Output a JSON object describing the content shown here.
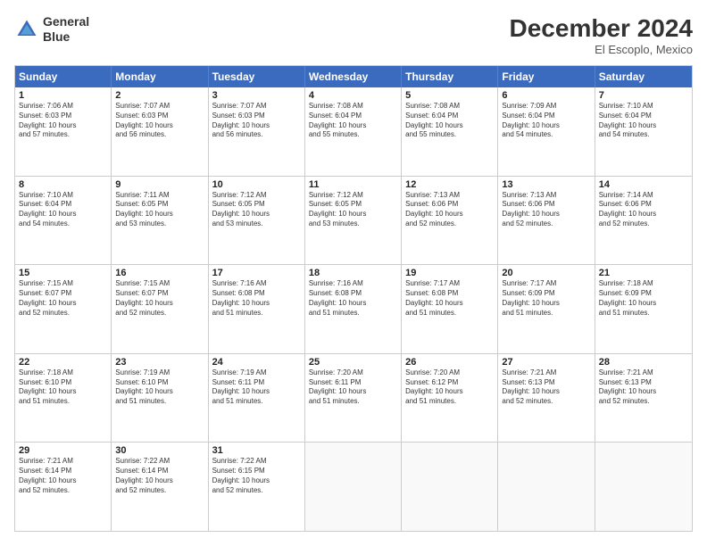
{
  "header": {
    "logo_line1": "General",
    "logo_line2": "Blue",
    "month": "December 2024",
    "location": "El Escoplo, Mexico"
  },
  "days_of_week": [
    "Sunday",
    "Monday",
    "Tuesday",
    "Wednesday",
    "Thursday",
    "Friday",
    "Saturday"
  ],
  "rows": [
    [
      {
        "day": "",
        "text": ""
      },
      {
        "day": "2",
        "text": "Sunrise: 7:07 AM\nSunset: 6:03 PM\nDaylight: 10 hours\nand 56 minutes."
      },
      {
        "day": "3",
        "text": "Sunrise: 7:07 AM\nSunset: 6:03 PM\nDaylight: 10 hours\nand 56 minutes."
      },
      {
        "day": "4",
        "text": "Sunrise: 7:08 AM\nSunset: 6:04 PM\nDaylight: 10 hours\nand 55 minutes."
      },
      {
        "day": "5",
        "text": "Sunrise: 7:08 AM\nSunset: 6:04 PM\nDaylight: 10 hours\nand 55 minutes."
      },
      {
        "day": "6",
        "text": "Sunrise: 7:09 AM\nSunset: 6:04 PM\nDaylight: 10 hours\nand 54 minutes."
      },
      {
        "day": "7",
        "text": "Sunrise: 7:10 AM\nSunset: 6:04 PM\nDaylight: 10 hours\nand 54 minutes."
      }
    ],
    [
      {
        "day": "8",
        "text": "Sunrise: 7:10 AM\nSunset: 6:04 PM\nDaylight: 10 hours\nand 54 minutes."
      },
      {
        "day": "9",
        "text": "Sunrise: 7:11 AM\nSunset: 6:05 PM\nDaylight: 10 hours\nand 53 minutes."
      },
      {
        "day": "10",
        "text": "Sunrise: 7:12 AM\nSunset: 6:05 PM\nDaylight: 10 hours\nand 53 minutes."
      },
      {
        "day": "11",
        "text": "Sunrise: 7:12 AM\nSunset: 6:05 PM\nDaylight: 10 hours\nand 53 minutes."
      },
      {
        "day": "12",
        "text": "Sunrise: 7:13 AM\nSunset: 6:06 PM\nDaylight: 10 hours\nand 52 minutes."
      },
      {
        "day": "13",
        "text": "Sunrise: 7:13 AM\nSunset: 6:06 PM\nDaylight: 10 hours\nand 52 minutes."
      },
      {
        "day": "14",
        "text": "Sunrise: 7:14 AM\nSunset: 6:06 PM\nDaylight: 10 hours\nand 52 minutes."
      }
    ],
    [
      {
        "day": "15",
        "text": "Sunrise: 7:15 AM\nSunset: 6:07 PM\nDaylight: 10 hours\nand 52 minutes."
      },
      {
        "day": "16",
        "text": "Sunrise: 7:15 AM\nSunset: 6:07 PM\nDaylight: 10 hours\nand 52 minutes."
      },
      {
        "day": "17",
        "text": "Sunrise: 7:16 AM\nSunset: 6:08 PM\nDaylight: 10 hours\nand 51 minutes."
      },
      {
        "day": "18",
        "text": "Sunrise: 7:16 AM\nSunset: 6:08 PM\nDaylight: 10 hours\nand 51 minutes."
      },
      {
        "day": "19",
        "text": "Sunrise: 7:17 AM\nSunset: 6:08 PM\nDaylight: 10 hours\nand 51 minutes."
      },
      {
        "day": "20",
        "text": "Sunrise: 7:17 AM\nSunset: 6:09 PM\nDaylight: 10 hours\nand 51 minutes."
      },
      {
        "day": "21",
        "text": "Sunrise: 7:18 AM\nSunset: 6:09 PM\nDaylight: 10 hours\nand 51 minutes."
      }
    ],
    [
      {
        "day": "22",
        "text": "Sunrise: 7:18 AM\nSunset: 6:10 PM\nDaylight: 10 hours\nand 51 minutes."
      },
      {
        "day": "23",
        "text": "Sunrise: 7:19 AM\nSunset: 6:10 PM\nDaylight: 10 hours\nand 51 minutes."
      },
      {
        "day": "24",
        "text": "Sunrise: 7:19 AM\nSunset: 6:11 PM\nDaylight: 10 hours\nand 51 minutes."
      },
      {
        "day": "25",
        "text": "Sunrise: 7:20 AM\nSunset: 6:11 PM\nDaylight: 10 hours\nand 51 minutes."
      },
      {
        "day": "26",
        "text": "Sunrise: 7:20 AM\nSunset: 6:12 PM\nDaylight: 10 hours\nand 51 minutes."
      },
      {
        "day": "27",
        "text": "Sunrise: 7:21 AM\nSunset: 6:13 PM\nDaylight: 10 hours\nand 52 minutes."
      },
      {
        "day": "28",
        "text": "Sunrise: 7:21 AM\nSunset: 6:13 PM\nDaylight: 10 hours\nand 52 minutes."
      }
    ],
    [
      {
        "day": "29",
        "text": "Sunrise: 7:21 AM\nSunset: 6:14 PM\nDaylight: 10 hours\nand 52 minutes."
      },
      {
        "day": "30",
        "text": "Sunrise: 7:22 AM\nSunset: 6:14 PM\nDaylight: 10 hours\nand 52 minutes."
      },
      {
        "day": "31",
        "text": "Sunrise: 7:22 AM\nSunset: 6:15 PM\nDaylight: 10 hours\nand 52 minutes."
      },
      {
        "day": "",
        "text": ""
      },
      {
        "day": "",
        "text": ""
      },
      {
        "day": "",
        "text": ""
      },
      {
        "day": "",
        "text": ""
      }
    ]
  ],
  "row0_extra": {
    "day1": {
      "day": "1",
      "text": "Sunrise: 7:06 AM\nSunset: 6:03 PM\nDaylight: 10 hours\nand 57 minutes."
    }
  }
}
